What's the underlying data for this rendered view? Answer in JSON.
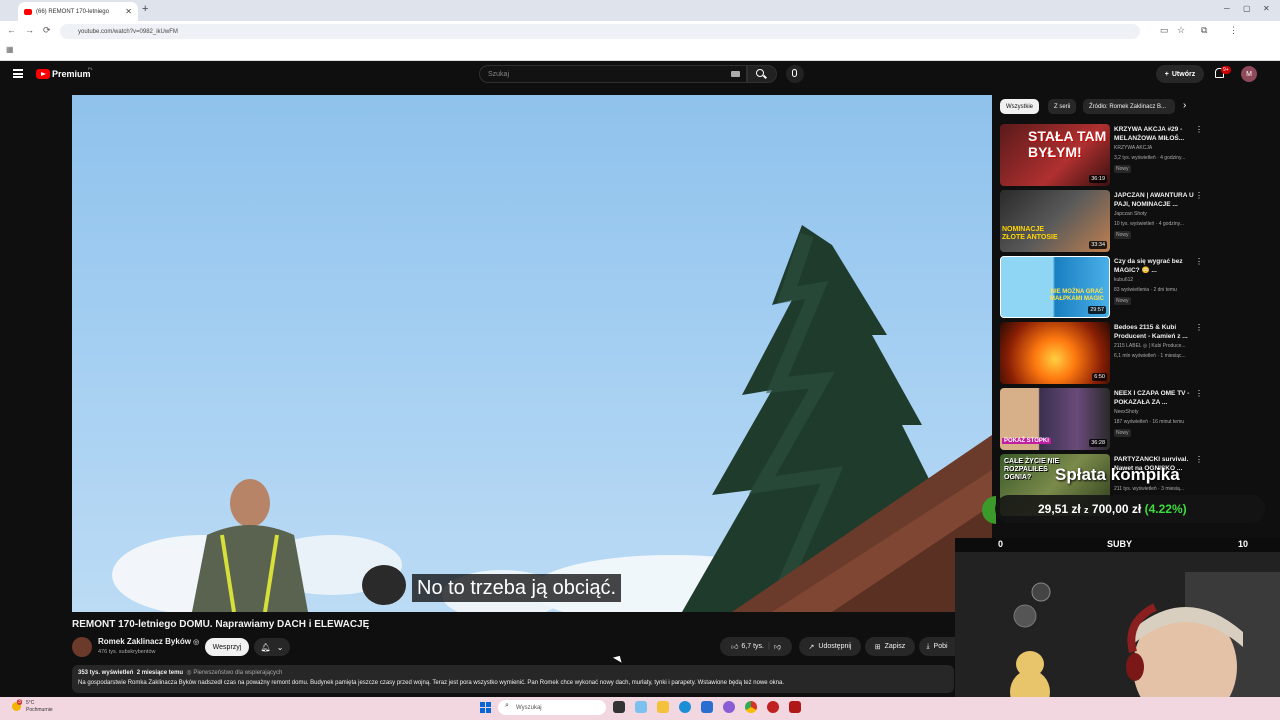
{
  "browser": {
    "tab_title": "(66) REMONT 170-letniego",
    "url": "youtube.com/watch?v=0982_ikUwFM"
  },
  "header": {
    "logo_label": "Premium",
    "region": "PL",
    "search_placeholder": "Szukaj",
    "create_label": "Utwórz",
    "notifications_count": "9+",
    "avatar_letter": "M"
  },
  "player": {
    "caption": "No to trzeba ją obciąć."
  },
  "video": {
    "title": "REMONT 170-letniego DOMU. Naprawiamy DACH i ELEWACJĘ",
    "channel_name": "Romek Zaklinacz Byków",
    "verified": "◎",
    "subscribers": "476 tys. subskrybentów",
    "support_label": "Wesprzyj",
    "likes": "6,7 tys.",
    "share_label": "Udostępnij",
    "save_label": "Zapisz",
    "download_label": "Pobi",
    "views": "353 tys. wyświetleń",
    "age": "2 miesiące temu",
    "priority": "Pierwszeństwo dla wspierających",
    "description": "Na gospodarstwie Romka Zaklinacza Byków nadszedł czas na poważny remont domu. Budynek pamięta jeszcze czasy przed wojną. Teraz jest pora wszystko wymienić. Pan Romek chce wykonać nowy dach, murłaty, tynki i parapety. Wstawione będą też nowe okna."
  },
  "chips": [
    "Wszystkie",
    "Z serii",
    "Źródło: Romek Zaklinacz B..."
  ],
  "recommendations": [
    {
      "title": "KRZYWA AKCJA #29 - MELANŻOWA MIŁOŚ...",
      "channel": "KRZYWA AKCJA",
      "stats": "3,2 tys. wyświetleń · 4 godziny...",
      "badge": "Nowy",
      "duration": "36:19",
      "thumb_text": "STAŁA TAM BYŁYM!",
      "accent": "#c0202a"
    },
    {
      "title": "JAPCZAN | AWANTURA U PAJI, NOMINACJE ...",
      "channel": "Japczan Shoty",
      "stats": "10 tys. wyświetleń · 4 godziny...",
      "badge": "Nowy",
      "duration": "33:34",
      "thumb_text": "NOMINACJE ZŁOTE ANTOSIE",
      "accent": "#e6c200"
    },
    {
      "title": "Czy da się wygrać bez MAGIC? 😳 ...",
      "channel": "kubu612",
      "stats": "83 wyświetlenia · 2 dni temu",
      "badge": "Nowy",
      "duration": "29:57",
      "thumb_text": "nie można grać małpkami magic",
      "accent": "#2aa7e0"
    },
    {
      "title": "Bedoes 2115 & Kubi Producent - Kamień z ...",
      "channel": "2115 LABEL ◎ | Kubi Produce...",
      "stats": "6,1 mln wyświetleń · 1 miesiąc...",
      "badge": "",
      "duration": "6:50",
      "thumb_text": "",
      "accent": "#d9530f"
    },
    {
      "title": "NEEX I CZAPA OME TV - POKAZAŁA ZA ...",
      "channel": "NeexShoty",
      "stats": "187 wyświetleń · 16 minut temu",
      "badge": "Nowy",
      "duration": "36:28",
      "thumb_text": "POKAŻ STOPKI",
      "accent": "#8a4fb5"
    },
    {
      "title": "PARTYZANCKI survival. Nawet na OGNISKO ...",
      "channel": "",
      "stats": "211 tys. wyświetleń · 3 miesią...",
      "badge": "",
      "duration": "",
      "thumb_text": "Całe życie nie rozpaliłeś OGNIA?",
      "accent": "#4a7a2a"
    }
  ],
  "overlay": {
    "title": "Spłata kompika",
    "current": "29,51 zł",
    "separator": "z",
    "goal": "700,00 zł",
    "percent": "(4.22%)",
    "subs_left": "0",
    "subs_label": "SUBY",
    "subs_right": "10"
  },
  "taskbar": {
    "temperature": "5°C",
    "weather": "Pochmurnie",
    "search_placeholder": "Wyszukaj",
    "weather_badge": "3"
  },
  "colors": {
    "youtube_red": "#ff0000",
    "accent_green": "#3ddc3d",
    "background": "#0f0f0f"
  }
}
